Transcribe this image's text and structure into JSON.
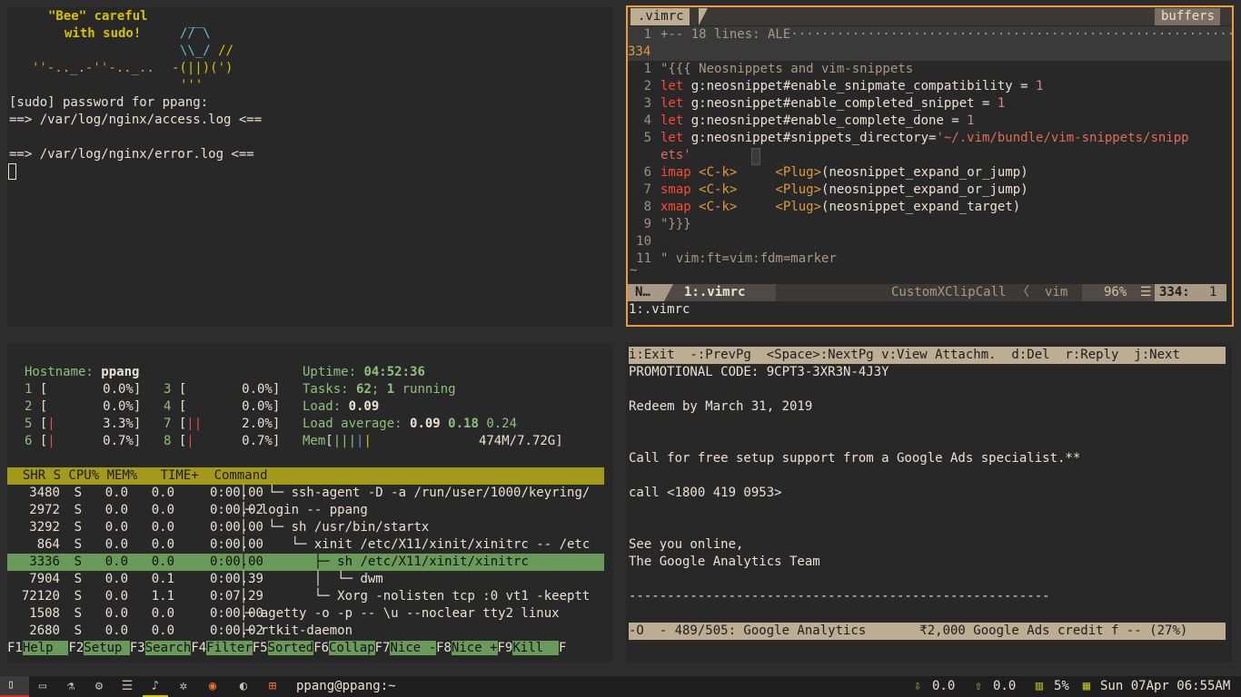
{
  "terminal1": {
    "cowsay": {
      "line1": "\"Bee\" careful",
      "line2": "with sudo!",
      "bee1": "__",
      "bee2": "// \\",
      "bee3a": "\\\\_/ ",
      "bee3b": "//",
      "trail": "''-.._.-''-.._..",
      "bee4": "-(||)(')",
      "bee5": "'''"
    },
    "lines": [
      "[sudo] password for ppang:",
      "==> /var/log/nginx/access.log <==",
      "",
      "==> /var/log/nginx/error.log <=="
    ]
  },
  "vim": {
    "tab_label": ".vimrc",
    "buffers_label": "buffers",
    "fold_line": "+-- 18 lines: ALE·······························································",
    "fold_linenum": "1",
    "cursor_line_num": "334",
    "lines": [
      {
        "n": "1",
        "parts": [
          {
            "t": "\"{{{ Neosnippets and vim-snippets",
            "c": "c-dim"
          }
        ]
      },
      {
        "n": "2",
        "parts": [
          {
            "t": "let ",
            "c": "c-red"
          },
          {
            "t": "g:neosnippet#enable_snipmate_compatibility = ",
            "c": "c-fg"
          },
          {
            "t": "1",
            "c": "c-num"
          }
        ]
      },
      {
        "n": "3",
        "parts": [
          {
            "t": "let ",
            "c": "c-red"
          },
          {
            "t": "g:neosnippet#enable_completed_snippet = ",
            "c": "c-fg"
          },
          {
            "t": "1",
            "c": "c-num"
          }
        ]
      },
      {
        "n": "4",
        "parts": [
          {
            "t": "let ",
            "c": "c-red"
          },
          {
            "t": "g:neosnippet#enable_complete_done = ",
            "c": "c-fg"
          },
          {
            "t": "1",
            "c": "c-num"
          }
        ]
      },
      {
        "n": "5",
        "parts": [
          {
            "t": "let ",
            "c": "c-red"
          },
          {
            "t": "g:neosnippet#snippets_directory=",
            "c": "c-fg"
          },
          {
            "t": "'~/.vim/bundle/vim-snippets/snipp",
            "c": "c-str"
          }
        ]
      },
      {
        "n": "",
        "parts": [
          {
            "t": "ets'",
            "c": "c-str"
          }
        ]
      },
      {
        "n": "6",
        "parts": [
          {
            "t": "imap ",
            "c": "c-red"
          },
          {
            "t": "<C-k>",
            "c": "c-orange"
          },
          {
            "t": "     ",
            "c": "c-fg"
          },
          {
            "t": "<Plug>",
            "c": "c-orange"
          },
          {
            "t": "(neosnippet_expand_or_jump)",
            "c": "c-fg"
          }
        ]
      },
      {
        "n": "7",
        "parts": [
          {
            "t": "smap ",
            "c": "c-red"
          },
          {
            "t": "<C-k>",
            "c": "c-orange"
          },
          {
            "t": "     ",
            "c": "c-fg"
          },
          {
            "t": "<Plug>",
            "c": "c-orange"
          },
          {
            "t": "(neosnippet_expand_or_jump)",
            "c": "c-fg"
          }
        ]
      },
      {
        "n": "8",
        "parts": [
          {
            "t": "xmap ",
            "c": "c-red"
          },
          {
            "t": "<C-k>",
            "c": "c-orange"
          },
          {
            "t": "     ",
            "c": "c-fg"
          },
          {
            "t": "<Plug>",
            "c": "c-orange"
          },
          {
            "t": "(neosnippet_expand_target)",
            "c": "c-fg"
          }
        ]
      },
      {
        "n": "9",
        "parts": [
          {
            "t": "\"}}}",
            "c": "c-dim"
          }
        ]
      },
      {
        "n": "10",
        "parts": []
      },
      {
        "n": "11",
        "parts": [
          {
            "t": "\" vim:ft=vim:fdm=marker",
            "c": "c-dim"
          }
        ]
      }
    ],
    "tilde": "~",
    "status": {
      "mode": "N…",
      "buffer": "1:.vimrc",
      "function": "CustomXClipCall",
      "filetype": "vim",
      "percent": "96%",
      "lineinfo": "334:",
      "col": "1"
    },
    "cmdline": "1:.vimrc"
  },
  "htop": {
    "hostname_label": "Hostname: ",
    "hostname": "ppang",
    "uptime_label": "Uptime: ",
    "uptime": "04:52:36",
    "tasks_label": "Tasks: ",
    "tasks": "62",
    "tasks_sep": "; ",
    "running_count": "1",
    "running_label": " running",
    "load_label": "Load: ",
    "load": "0.09",
    "loadavg_label": "Load average: ",
    "loadavg1": "0.09",
    "loadavg5": "0.18",
    "loadavg15": "0.24",
    "mem_label": "Mem",
    "mem_value": "474M/7.72G",
    "cpus": [
      {
        "id": "1",
        "bar": "",
        "pct": "0.0%]"
      },
      {
        "id": "3",
        "bar": "",
        "pct": "0.0%]"
      },
      {
        "id": "2",
        "bar": "",
        "pct": "0.0%]"
      },
      {
        "id": "4",
        "bar": "",
        "pct": "0.0%]"
      },
      {
        "id": "5",
        "bar": "|",
        "pct": "3.3%]"
      },
      {
        "id": "7",
        "bar": "||",
        "pct": "2.0%]"
      },
      {
        "id": "6",
        "bar": "|",
        "pct": "0.7%]"
      },
      {
        "id": "8",
        "bar": "|",
        "pct": "0.7%]"
      }
    ],
    "header": "  SHR S CPU% MEM%   TIME+  Command",
    "rows": [
      {
        "shr": " 3480",
        "s": "S",
        "cpu": " 0.0",
        "mem": " 0.0",
        "time": "0:00.00",
        "tree": "   └─ ",
        "cmd": "ssh-agent -D -a /run/user/1000/keyring/"
      },
      {
        "shr": " 2972",
        "s": "S",
        "cpu": " 0.0",
        "mem": " 0.0",
        "time": "0:00.02",
        "tree": "─ ",
        "cmd": "login -- ppang"
      },
      {
        "shr": " 3292",
        "s": "S",
        "cpu": " 0.0",
        "mem": " 0.0",
        "time": "0:00.00",
        "tree": "   └─ ",
        "cmd": "sh /usr/bin/startx"
      },
      {
        "shr": "  864",
        "s": "S",
        "cpu": " 0.0",
        "mem": " 0.0",
        "time": "0:00.00",
        "tree": "      └─ ",
        "cmd": "xinit /etc/X11/xinit/xinitrc -- /etc"
      },
      {
        "shr": " 3336",
        "s": "S",
        "cpu": " 0.0",
        "mem": " 0.0",
        "time": "0:00.00",
        "tree": "         ├─ ",
        "cmd": "sh /etc/X11/xinit/xinitrc"
      },
      {
        "shr": " 7904",
        "s": "S",
        "cpu": " 0.0",
        "mem": " 0.1",
        "time": "0:00.39",
        "tree": "         │  └─ ",
        "cmd": "dwm"
      },
      {
        "shr": "72120",
        "s": "S",
        "cpu": " 0.0",
        "mem": " 1.1",
        "time": "0:07.29",
        "tree": "         └─ ",
        "cmd": "Xorg -nolisten tcp :0 vt1 -keeptt"
      },
      {
        "shr": " 1508",
        "s": "S",
        "cpu": " 0.0",
        "mem": " 0.0",
        "time": "0:00.00",
        "tree": "─ ",
        "cmd": "agetty -o -p -- \\u --noclear tty2 linux"
      },
      {
        "shr": " 2680",
        "s": "S",
        "cpu": " 0.0",
        "mem": " 0.0",
        "time": "0:00.02",
        "tree": "─ ",
        "cmd": "rtkit-daemon"
      }
    ],
    "fkeys": [
      {
        "k": "F1",
        "d": "Help  "
      },
      {
        "k": "F2",
        "d": "Setup "
      },
      {
        "k": "F3",
        "d": "Search"
      },
      {
        "k": "F4",
        "d": "Filter"
      },
      {
        "k": "F5",
        "d": "Sorted"
      },
      {
        "k": "F6",
        "d": "Collap"
      },
      {
        "k": "F7",
        "d": "Nice -"
      },
      {
        "k": "F8",
        "d": "Nice +"
      },
      {
        "k": "F9",
        "d": "Kill  "
      },
      {
        "k": "F",
        "d": ""
      }
    ]
  },
  "mutt": {
    "help_bar": "i:Exit  -:PrevPg  <Space>:NextPg v:View Attachm.  d:Del  r:Reply  j:Next",
    "lines": [
      "PROMOTIONAL CODE: 9CPT3-3XR3N-4J3Y",
      "",
      "Redeem by March 31, 2019",
      "",
      "",
      "Call for free setup support from a Google Ads specialist.**",
      "",
      "call <1800 419 0953>",
      "",
      "",
      "See you online,",
      "The Google Analytics Team",
      "",
      "-------------------------------------------------------"
    ],
    "status_bar": "-O  - 489/505: Google Analytics       ₹2,000 Google Ads credit f -- (27%)"
  },
  "taskbar": {
    "title": "ppang@ppang:~",
    "net_down": "0.0",
    "net_up": "0.0",
    "cpu": "5%",
    "datetime": "Sun 07Apr 06:55AM"
  }
}
